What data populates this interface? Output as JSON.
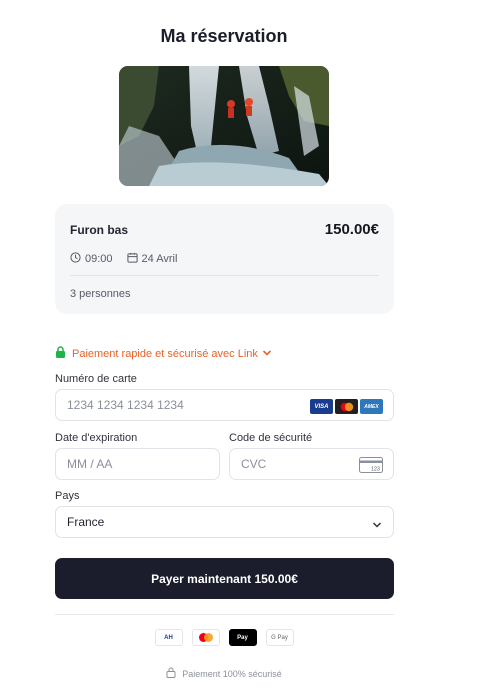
{
  "header": {
    "title": "Ma réservation"
  },
  "summary": {
    "activity": "Furon bas",
    "price": "150.00€",
    "time": "09:00",
    "date": "24 Avril",
    "people": "3 personnes"
  },
  "link": {
    "label": "Paiement rapide et sécurisé avec Link"
  },
  "form": {
    "card_number_label": "Numéro de carte",
    "card_number_placeholder": "1234 1234 1234 1234",
    "expiry_label": "Date d'expiration",
    "expiry_placeholder": "MM / AA",
    "cvc_label": "Code de sécurité",
    "cvc_placeholder": "CVC",
    "cvc_icon_text": "123",
    "country_label": "Pays",
    "country_value": "France"
  },
  "card_brands": [
    {
      "name": "visa-icon",
      "text": "VISA",
      "color": "#1a3c8f"
    },
    {
      "name": "mastercard-icon",
      "text": "",
      "color": "#231f20"
    },
    {
      "name": "amex-icon",
      "text": "AMEX",
      "color": "#2e77bb"
    }
  ],
  "pay_button": {
    "label": "Payer maintenant 150.00€"
  },
  "payment_methods": [
    {
      "name": "ah-pay-icon",
      "text": "AH",
      "color": "#1a3c8f"
    },
    {
      "name": "mastercard-method-icon",
      "text": "",
      "color": "#ffffff"
    },
    {
      "name": "apple-pay-icon",
      "text": "Pay",
      "color": "#000000"
    },
    {
      "name": "google-pay-icon",
      "text": "G Pay",
      "color": "#ffffff"
    }
  ],
  "footer": {
    "secure_text": "Paiement 100% sécurisé"
  },
  "colors": {
    "accent": "#e8632a",
    "primary": "#1b1c2c",
    "lock": "#1fb34a"
  }
}
